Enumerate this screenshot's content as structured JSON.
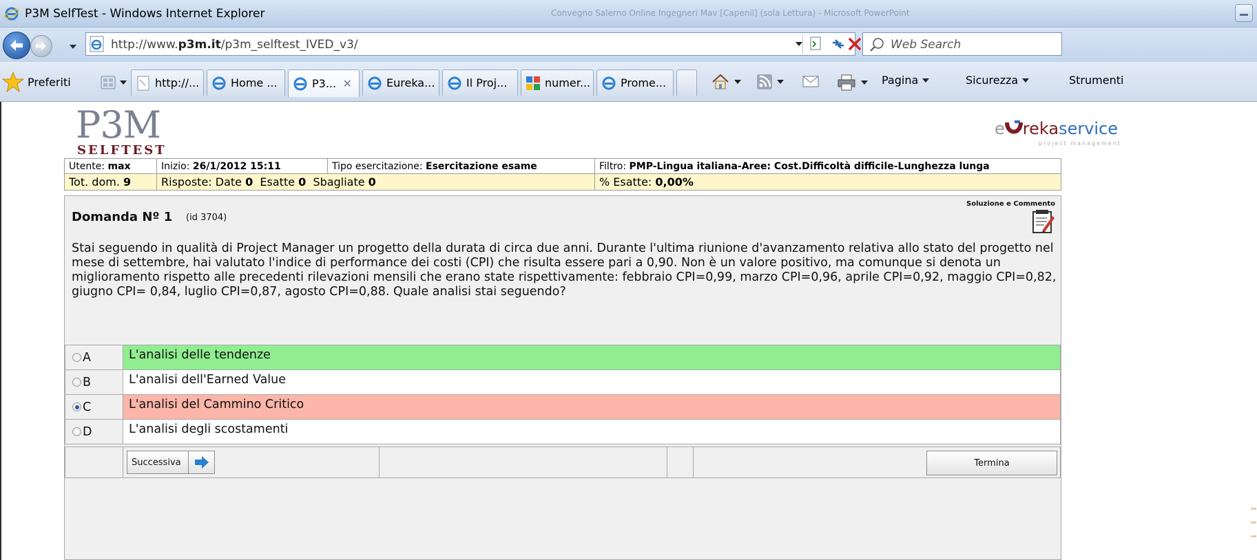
{
  "window": {
    "title": "P3M SelfTest - Windows Internet Explorer",
    "background_title": "Convegno Salerno Online Ingegneri Mav [Capenil] (sola Lettura) - Microsoft PowerPoint"
  },
  "address": {
    "url_prefix": "http://www.",
    "url_domain": "p3m.it",
    "url_path": "/p3m_selftest_IVED_v3/",
    "search_placeholder": "Web Search"
  },
  "favorites": {
    "label": "Preferiti"
  },
  "tabs": [
    {
      "label": "http://..."
    },
    {
      "label": "Home ..."
    },
    {
      "label": "P3..."
    },
    {
      "label": "Eureka..."
    },
    {
      "label": "Il Proj..."
    },
    {
      "label": "numer..."
    },
    {
      "label": "Prome..."
    }
  ],
  "toolbar": {
    "pagina": "Pagina",
    "sicurezza": "Sicurezza",
    "strumenti": "Strumenti"
  },
  "logos": {
    "p3m": "P3M",
    "selftest": "SELFTEST",
    "eureka": "eUreka service",
    "eureka_prefix": "e",
    "eureka_brand": "reka",
    "eureka_suffix": "service",
    "eureka_tagline": "project management"
  },
  "info": {
    "utente_label": "Utente:",
    "utente": "max",
    "inizio_label": "Inizio:",
    "inizio": "26/1/2012 15:11",
    "tipo_label": "Tipo esercitazione:",
    "tipo": "Esercitazione esame",
    "filtro_label": "Filtro:",
    "filtro": "PMP-Lingua italiana-Aree: Cost.Difficoltà difficile-Lunghezza lunga",
    "totdom_label": "Tot. dom.",
    "totdom": "9",
    "risposte_label": "Risposte: Date",
    "date": "0",
    "esatte_label": "Esatte",
    "esatte": "0",
    "sbagliate_label": "Sbagliate",
    "sbagliate": "0",
    "perc_label": "% Esatte:",
    "perc": "0,00%"
  },
  "question": {
    "number_label": "Domanda Nº 1",
    "id_label": "(id 3704)",
    "solution_label": "Soluzione e Commento",
    "text": "Stai seguendo in qualità di Project Manager un progetto della durata di circa due anni. Durante l'ultima riunione d'avanzamento relativa allo stato del progetto nel mese di settembre, hai valutato l'indice di performance dei costi (CPI) che risulta essere pari a 0,90. Non è un valore positivo, ma comunque si denota un miglioramento rispetto alle precedenti rilevazioni mensili che erano state rispettivamente: febbraio CPI=0,99, marzo CPI=0,96, aprile CPI=0,92, maggio CPI=0,82, giugno CPI= 0,84, luglio CPI=0,87, agosto CPI=0,88. Quale analisi stai seguendo?",
    "answers": [
      {
        "letter": "A",
        "text": "L'analisi delle tendenze",
        "state": "correct",
        "selected": false
      },
      {
        "letter": "B",
        "text": "L'analisi dell'Earned Value",
        "state": "plain",
        "selected": false
      },
      {
        "letter": "C",
        "text": "L'analisi del Cammino Critico",
        "state": "wrong",
        "selected": true
      },
      {
        "letter": "D",
        "text": "L'analisi degli scostamenti",
        "state": "plain",
        "selected": false
      }
    ],
    "next_label": "Successiva",
    "end_label": "Termina"
  },
  "colors": {
    "correct": "#90ee90",
    "wrong": "#fbb5a9",
    "info_row": "#fff6cc",
    "panel": "#f0f0f0",
    "accent": "#2a7fd0"
  }
}
